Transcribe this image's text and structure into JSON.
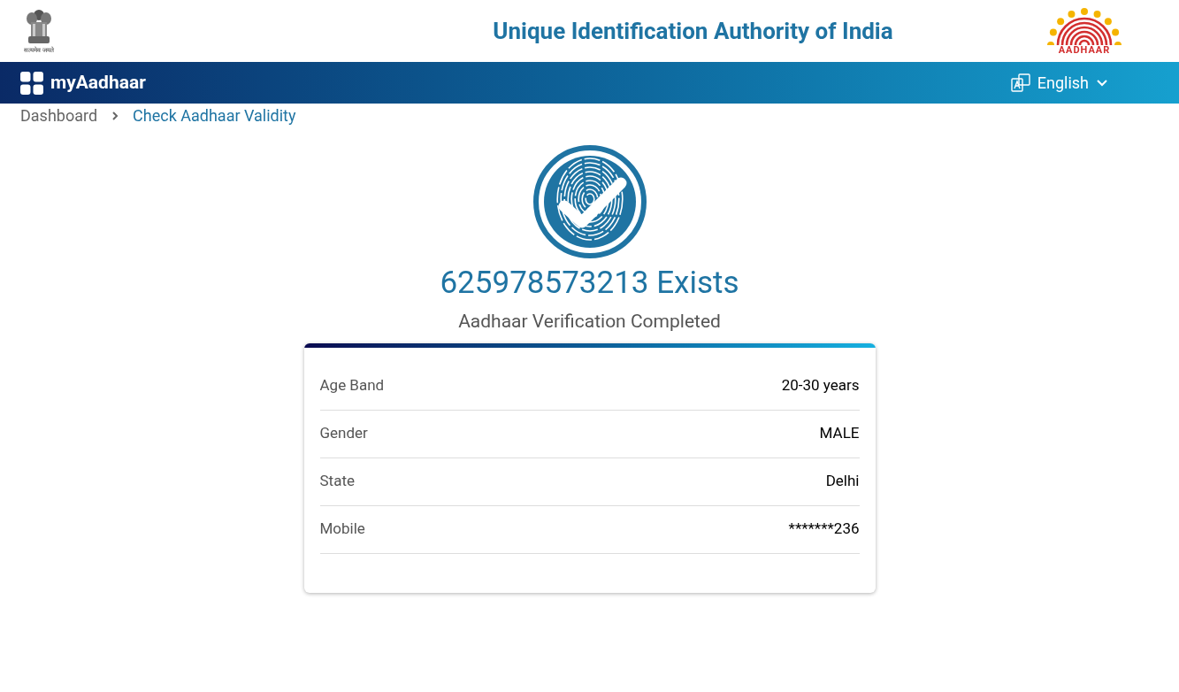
{
  "header": {
    "emblem_motto": "सत्यमेव जयते",
    "title": "Unique Identification Authority of India",
    "logo_text": "AADHAAR"
  },
  "navbar": {
    "brand": "myAadhaar",
    "language": "English"
  },
  "breadcrumb": [
    "Dashboard",
    "Check Aadhaar Validity"
  ],
  "result": {
    "heading": "625978573213 Exists",
    "subheading": "Aadhaar Verification Completed"
  },
  "details": [
    {
      "label": "Age Band",
      "value": "20-30 years"
    },
    {
      "label": "Gender",
      "value": "MALE"
    },
    {
      "label": "State",
      "value": "Delhi"
    },
    {
      "label": "Mobile",
      "value": "*******236"
    }
  ]
}
